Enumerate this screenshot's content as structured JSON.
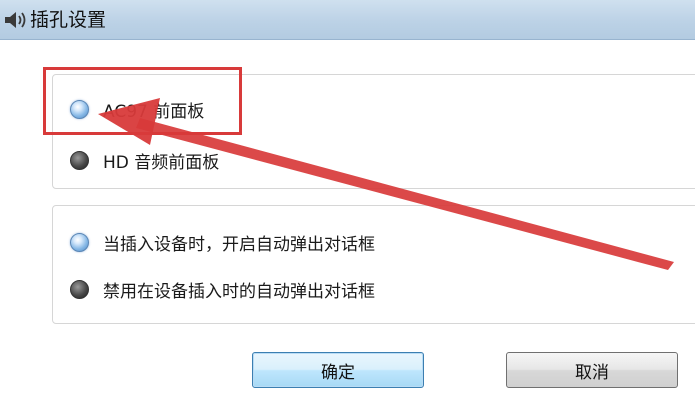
{
  "window": {
    "title": "插孔设置",
    "icon": "speaker-icon"
  },
  "front_panel_group": {
    "options": [
      {
        "label": "AC97 前面板",
        "selected": true
      },
      {
        "label": "HD 音频前面板",
        "selected": false
      }
    ]
  },
  "popup_group": {
    "options": [
      {
        "label": "当插入设备时，开启自动弹出对话框",
        "selected": true
      },
      {
        "label": "禁用在设备插入时的自动弹出对话框",
        "selected": false
      }
    ]
  },
  "buttons": {
    "ok_label": "确定",
    "cancel_label": "取消"
  },
  "annotation": {
    "highlight_color": "#d83a3a",
    "arrow_color": "#d83a3a"
  },
  "colors": {
    "titlebar": "#bcd2e6",
    "radio_selected": "#86b8e6",
    "radio_unselected": "#2a2a2a"
  }
}
